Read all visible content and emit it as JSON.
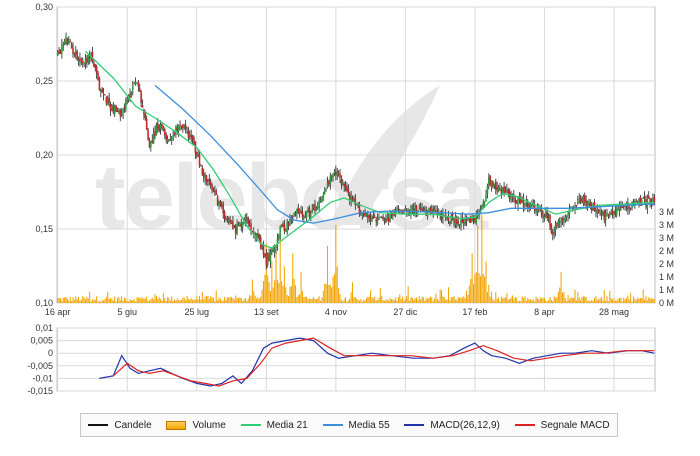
{
  "chart_data": [
    {
      "type": "line",
      "subtype": "candlestick+volume",
      "title": "",
      "ylim": [
        0.1,
        0.3
      ],
      "y_ticks": [
        "0,30",
        "0,25",
        "0,20",
        "0,15",
        "0,10"
      ],
      "y_tick_values": [
        0.3,
        0.25,
        0.2,
        0.15,
        0.1
      ],
      "x_ticks": [
        "16 apr",
        "5 giu",
        "25 lug",
        "13 set",
        "4 nov",
        "27 dic",
        "17 feb",
        "8 apr",
        "28 mag"
      ],
      "x_tick_index": [
        0,
        50,
        100,
        150,
        200,
        250,
        300,
        350,
        400
      ],
      "num_periods": 430,
      "close_anchors": [
        [
          0,
          0.268
        ],
        [
          6,
          0.278
        ],
        [
          10,
          0.272
        ],
        [
          18,
          0.262
        ],
        [
          24,
          0.268
        ],
        [
          30,
          0.245
        ],
        [
          38,
          0.233
        ],
        [
          44,
          0.228
        ],
        [
          50,
          0.236
        ],
        [
          56,
          0.252
        ],
        [
          60,
          0.238
        ],
        [
          66,
          0.207
        ],
        [
          72,
          0.22
        ],
        [
          80,
          0.21
        ],
        [
          88,
          0.222
        ],
        [
          96,
          0.212
        ],
        [
          104,
          0.188
        ],
        [
          112,
          0.175
        ],
        [
          120,
          0.16
        ],
        [
          128,
          0.15
        ],
        [
          136,
          0.158
        ],
        [
          144,
          0.143
        ],
        [
          150,
          0.128
        ],
        [
          156,
          0.138
        ],
        [
          160,
          0.15
        ],
        [
          166,
          0.153
        ],
        [
          172,
          0.162
        ],
        [
          180,
          0.16
        ],
        [
          188,
          0.168
        ],
        [
          194,
          0.18
        ],
        [
          200,
          0.188
        ],
        [
          206,
          0.18
        ],
        [
          212,
          0.168
        ],
        [
          220,
          0.16
        ],
        [
          228,
          0.157
        ],
        [
          236,
          0.155
        ],
        [
          244,
          0.163
        ],
        [
          252,
          0.164
        ],
        [
          260,
          0.162
        ],
        [
          270,
          0.161
        ],
        [
          280,
          0.157
        ],
        [
          290,
          0.155
        ],
        [
          300,
          0.155
        ],
        [
          306,
          0.168
        ],
        [
          310,
          0.183
        ],
        [
          316,
          0.178
        ],
        [
          322,
          0.175
        ],
        [
          330,
          0.17
        ],
        [
          338,
          0.166
        ],
        [
          346,
          0.162
        ],
        [
          352,
          0.158
        ],
        [
          356,
          0.148
        ],
        [
          362,
          0.156
        ],
        [
          370,
          0.166
        ],
        [
          378,
          0.17
        ],
        [
          386,
          0.163
        ],
        [
          394,
          0.158
        ],
        [
          402,
          0.163
        ],
        [
          410,
          0.166
        ],
        [
          418,
          0.168
        ],
        [
          429,
          0.169
        ]
      ],
      "ma21_anchors": [
        [
          20,
          0.27
        ],
        [
          40,
          0.252
        ],
        [
          56,
          0.233
        ],
        [
          70,
          0.225
        ],
        [
          86,
          0.215
        ],
        [
          100,
          0.205
        ],
        [
          112,
          0.19
        ],
        [
          124,
          0.172
        ],
        [
          136,
          0.152
        ],
        [
          146,
          0.14
        ],
        [
          154,
          0.137
        ],
        [
          162,
          0.143
        ],
        [
          172,
          0.15
        ],
        [
          182,
          0.157
        ],
        [
          196,
          0.168
        ],
        [
          206,
          0.171
        ],
        [
          218,
          0.166
        ],
        [
          232,
          0.161
        ],
        [
          250,
          0.16
        ],
        [
          270,
          0.16
        ],
        [
          290,
          0.157
        ],
        [
          300,
          0.158
        ],
        [
          310,
          0.168
        ],
        [
          320,
          0.174
        ],
        [
          330,
          0.172
        ],
        [
          344,
          0.166
        ],
        [
          358,
          0.16
        ],
        [
          372,
          0.163
        ],
        [
          390,
          0.166
        ],
        [
          410,
          0.167
        ],
        [
          429,
          0.168
        ]
      ],
      "ma55_anchors": [
        [
          70,
          0.247
        ],
        [
          90,
          0.231
        ],
        [
          110,
          0.213
        ],
        [
          130,
          0.193
        ],
        [
          146,
          0.176
        ],
        [
          158,
          0.163
        ],
        [
          170,
          0.156
        ],
        [
          184,
          0.154
        ],
        [
          200,
          0.157
        ],
        [
          218,
          0.161
        ],
        [
          236,
          0.162
        ],
        [
          256,
          0.162
        ],
        [
          276,
          0.161
        ],
        [
          296,
          0.16
        ],
        [
          310,
          0.161
        ],
        [
          326,
          0.164
        ],
        [
          346,
          0.164
        ],
        [
          366,
          0.164
        ],
        [
          388,
          0.165
        ],
        [
          410,
          0.166
        ],
        [
          429,
          0.167
        ]
      ],
      "volume_axis": {
        "max": 3.5,
        "unit": "M",
        "ticks": [
          "3 M",
          "3 M",
          "3 M",
          "2 M",
          "2 M",
          "1 M",
          "1 M",
          "0 M"
        ],
        "tick_values": [
          3.5,
          3.0,
          2.5,
          2.0,
          1.5,
          1.0,
          0.5,
          0.0
        ]
      },
      "volume_spikes": [
        [
          150,
          2.3
        ],
        [
          154,
          1.6
        ],
        [
          157,
          1.9
        ],
        [
          160,
          2.6
        ],
        [
          163,
          1.4
        ],
        [
          169,
          1.9
        ],
        [
          175,
          1.2
        ],
        [
          194,
          2.2
        ],
        [
          200,
          3.0
        ],
        [
          198,
          1.0
        ],
        [
          212,
          0.8
        ],
        [
          302,
          3.0
        ],
        [
          305,
          3.4
        ],
        [
          308,
          1.6
        ],
        [
          298,
          1.9
        ],
        [
          362,
          1.2
        ],
        [
          300,
          1.1
        ],
        [
          140,
          0.9
        ],
        [
          310,
          0.7
        ]
      ]
    },
    {
      "type": "line",
      "title": "",
      "ylim": [
        -0.015,
        0.01
      ],
      "y_ticks": [
        "0,01",
        "0,005",
        "0",
        "-0,005",
        "-0,01",
        "-0,015"
      ],
      "y_tick_values": [
        0.01,
        0.005,
        0.0,
        -0.005,
        -0.01,
        -0.015
      ],
      "series": [
        {
          "name": "MACD(26,12,9)",
          "color": "#2233aa",
          "points": [
            [
              30,
              -0.01
            ],
            [
              40,
              -0.009
            ],
            [
              46,
              -0.001
            ],
            [
              52,
              -0.006
            ],
            [
              58,
              -0.008
            ],
            [
              66,
              -0.007
            ],
            [
              74,
              -0.006
            ],
            [
              82,
              -0.008
            ],
            [
              90,
              -0.01
            ],
            [
              100,
              -0.012
            ],
            [
              110,
              -0.013
            ],
            [
              118,
              -0.012
            ],
            [
              126,
              -0.009
            ],
            [
              132,
              -0.012
            ],
            [
              140,
              -0.007
            ],
            [
              148,
              0.002
            ],
            [
              154,
              0.004
            ],
            [
              164,
              0.005
            ],
            [
              174,
              0.006
            ],
            [
              184,
              0.005
            ],
            [
              194,
              0.0
            ],
            [
              202,
              -0.002
            ],
            [
              214,
              -0.001
            ],
            [
              226,
              0.0
            ],
            [
              240,
              -0.001
            ],
            [
              256,
              -0.002
            ],
            [
              270,
              -0.002
            ],
            [
              282,
              -0.001
            ],
            [
              292,
              0.002
            ],
            [
              300,
              0.004
            ],
            [
              306,
              0.001
            ],
            [
              312,
              -0.001
            ],
            [
              322,
              -0.002
            ],
            [
              332,
              -0.004
            ],
            [
              342,
              -0.002
            ],
            [
              352,
              -0.001
            ],
            [
              362,
              0.0
            ],
            [
              372,
              0.0
            ],
            [
              384,
              0.001
            ],
            [
              396,
              0.0
            ],
            [
              410,
              0.001
            ],
            [
              420,
              0.001
            ],
            [
              429,
              0.0
            ]
          ]
        },
        {
          "name": "Segnale MACD",
          "color": "#dd2222",
          "points": [
            [
              40,
              -0.009
            ],
            [
              50,
              -0.004
            ],
            [
              58,
              -0.007
            ],
            [
              66,
              -0.008
            ],
            [
              76,
              -0.007
            ],
            [
              86,
              -0.009
            ],
            [
              96,
              -0.011
            ],
            [
              106,
              -0.012
            ],
            [
              116,
              -0.013
            ],
            [
              126,
              -0.011
            ],
            [
              136,
              -0.01
            ],
            [
              146,
              -0.004
            ],
            [
              154,
              0.002
            ],
            [
              164,
              0.004
            ],
            [
              174,
              0.005
            ],
            [
              184,
              0.006
            ],
            [
              196,
              0.002
            ],
            [
              206,
              -0.001
            ],
            [
              220,
              -0.001
            ],
            [
              236,
              -0.001
            ],
            [
              254,
              -0.001
            ],
            [
              270,
              -0.002
            ],
            [
              284,
              -0.001
            ],
            [
              296,
              0.001
            ],
            [
              306,
              0.003
            ],
            [
              316,
              0.001
            ],
            [
              328,
              -0.002
            ],
            [
              340,
              -0.003
            ],
            [
              352,
              -0.002
            ],
            [
              364,
              -0.001
            ],
            [
              378,
              0.0
            ],
            [
              392,
              0.0
            ],
            [
              408,
              0.001
            ],
            [
              420,
              0.001
            ],
            [
              429,
              0.001
            ]
          ]
        }
      ]
    }
  ],
  "legend": {
    "items": [
      {
        "label": "Candele",
        "color": "#111111",
        "kind": "line"
      },
      {
        "label": "Volume",
        "color": "#f2a300",
        "kind": "box"
      },
      {
        "label": "Media 21",
        "color": "#33cc77",
        "kind": "line"
      },
      {
        "label": "Media 55",
        "color": "#3b8fdb",
        "kind": "line"
      },
      {
        "label": "MACD(26,12,9)",
        "color": "#2233aa",
        "kind": "line"
      },
      {
        "label": "Segnale MACD",
        "color": "#dd2222",
        "kind": "line"
      }
    ]
  },
  "colors": {
    "candle_up": "#2e9e3e",
    "candle_down": "#c22a2a",
    "candle_wick": "#222222",
    "volume": "#f2a300",
    "grid": "#d9d9d9",
    "watermark": "#e7e7e7"
  },
  "watermark": "teleborsa",
  "watermark_mark": "logo"
}
